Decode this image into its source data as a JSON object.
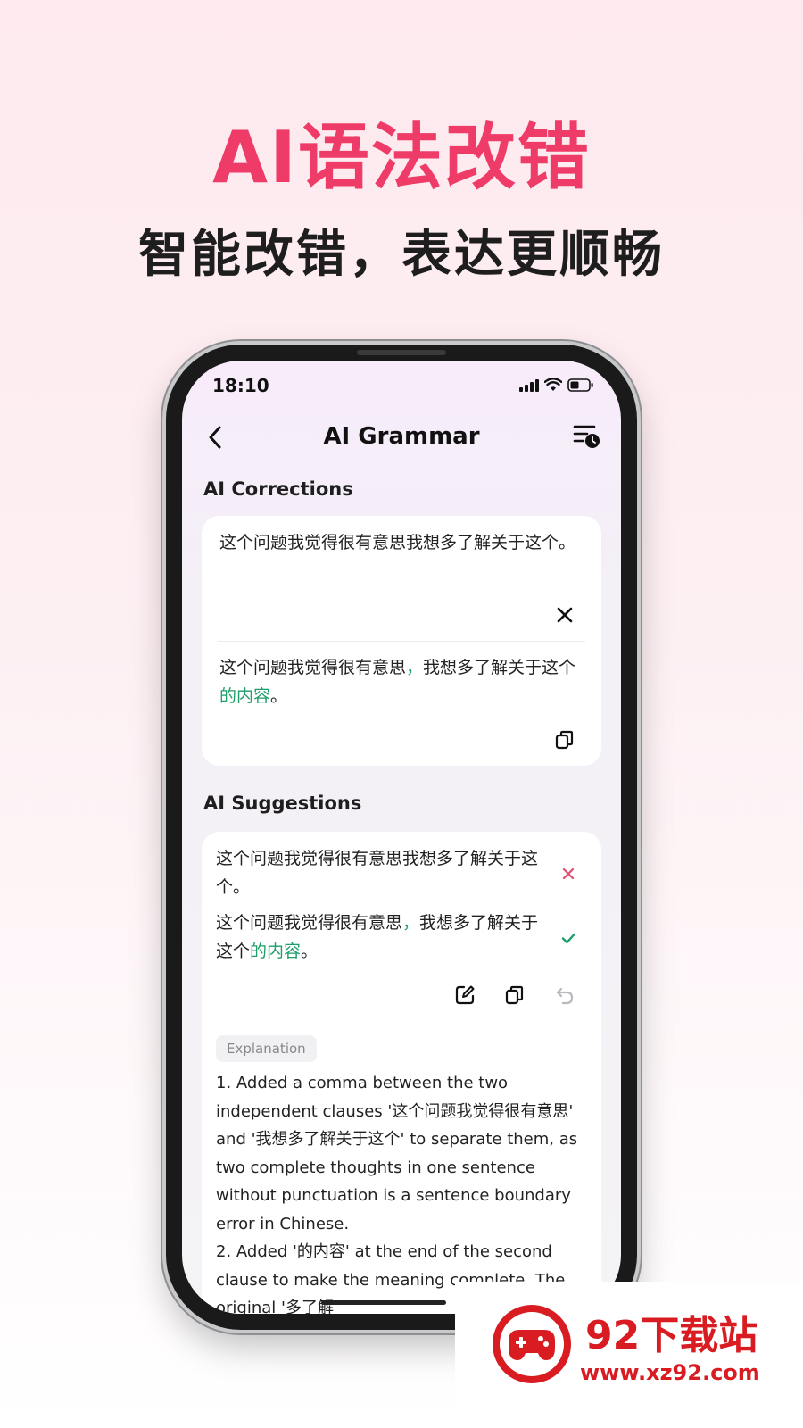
{
  "promo": {
    "title": "AI语法改错",
    "subtitle": "智能改错，表达更顺畅"
  },
  "status_bar": {
    "time": "18:10"
  },
  "nav": {
    "title": "AI Grammar"
  },
  "corrections": {
    "label": "AI Corrections",
    "original_text": "这个问题我觉得很有意思我想多了解关于这个。",
    "corrected": {
      "p1": "这个问题我觉得很有意思",
      "h1": "，",
      "p2": "我想多了解关于这个",
      "h2": "的内容",
      "p3": "。"
    }
  },
  "suggestions": {
    "label": "AI Suggestions",
    "original_text": "这个问题我觉得很有意思我想多了解关于这个。",
    "corrected": {
      "p1": "这个问题我觉得很有意思",
      "h1": "，",
      "p2": "我想多了解关于这个",
      "h2": "的内容",
      "p3": "。"
    },
    "explanation_label": "Explanation",
    "explanation_text": "1. Added a comma between the two independent clauses '这个问题我觉得很有意思' and '我想多了解关于这个' to separate them, as two complete thoughts in one sentence without punctuation is a sentence boundary error in Chinese.\n2. Added '的内容' at the end of the second clause to make the meaning complete. The original '多了解"
  },
  "colors": {
    "accent": "#ee3b67",
    "highlight": "#1f9e6a",
    "reject": "#e44d6f"
  },
  "icons": [
    "back-arrow-icon",
    "history-icon",
    "close-icon",
    "copy-icon",
    "edit-icon",
    "undo-icon",
    "check-icon"
  ],
  "watermark": {
    "name": "92下载站",
    "url": "www.xz92.com"
  }
}
